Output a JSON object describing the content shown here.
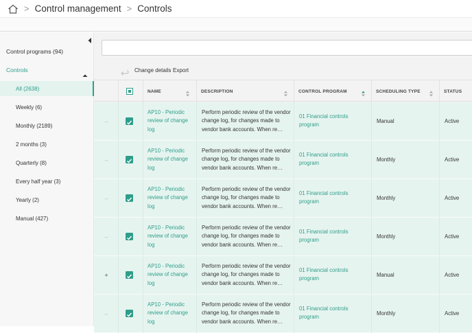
{
  "breadcrumb": {
    "items": [
      "Control management",
      "Controls"
    ],
    "separator": ">"
  },
  "sidebar": {
    "control_programs": "Control programs (94)",
    "controls_section": "Controls",
    "items": [
      {
        "label": "All (2638)",
        "active": true
      },
      {
        "label": "Weekly (6)"
      },
      {
        "label": "Monthly (2189)"
      },
      {
        "label": "2 months (3)"
      },
      {
        "label": "Quarterly (8)"
      },
      {
        "label": "Every half year (3)"
      },
      {
        "label": "Yearly (2)"
      },
      {
        "label": "Manual (427)"
      }
    ]
  },
  "search": {
    "value": "",
    "placeholder": ""
  },
  "toolbar": {
    "change_details": "Change details",
    "export": "Export"
  },
  "table": {
    "columns": [
      "NAME",
      "DESCRIPTION",
      "CONTROL PROGRAM",
      "SCHEDULING TYPE",
      "STATUS"
    ],
    "rows": [
      {
        "expander": "–",
        "name": "AP10 - Periodic review of change log",
        "description": "Perform periodic review of the vendor change log, for changes made to vendor bank accounts. When re…",
        "program": "01 Financial controls program",
        "scheduling": "Manual",
        "status": "Active"
      },
      {
        "expander": "–",
        "name": "AP10 - Periodic review of change log",
        "description": "Perform periodic review of the vendor change log, for changes made to vendor bank accounts. When re…",
        "program": "01 Financial controls program",
        "scheduling": "Monthly",
        "status": "Active"
      },
      {
        "expander": "–",
        "name": "AP10 - Periodic review of change log",
        "description": "Perform periodic review of the vendor change log, for changes made to vendor bank accounts. When re…",
        "program": "01 Financial controls program",
        "scheduling": "Monthly",
        "status": "Active"
      },
      {
        "expander": "–",
        "name": "AP10 - Periodic review of change log",
        "description": "Perform periodic review of the vendor change log, for changes made to vendor bank accounts. When re…",
        "program": "01 Financial controls program",
        "scheduling": "Monthly",
        "status": "Active"
      },
      {
        "expander": "+",
        "name": "AP10 - Periodic review of change log",
        "description": "Perform periodic review of the vendor change log, for changes made to vendor bank accounts. When re…",
        "program": "01 Financial controls program",
        "scheduling": "Manual",
        "status": "Active"
      },
      {
        "expander": "–",
        "name": "AP10 - Periodic review of change log",
        "description": "Perform periodic review of the vendor change log, for changes made to vendor bank accounts. When re…",
        "program": "01 Financial controls program",
        "scheduling": "Monthly",
        "status": "Active"
      }
    ]
  },
  "colors": {
    "accent": "#2e9e8a",
    "row_highlight": "#e6f4ef",
    "sidebar_bg": "#f7f7f7"
  },
  "icons": {
    "home": "home-icon",
    "collapse": "collapse-left-icon",
    "undo": "undo-icon",
    "sort": "sort-icon"
  }
}
